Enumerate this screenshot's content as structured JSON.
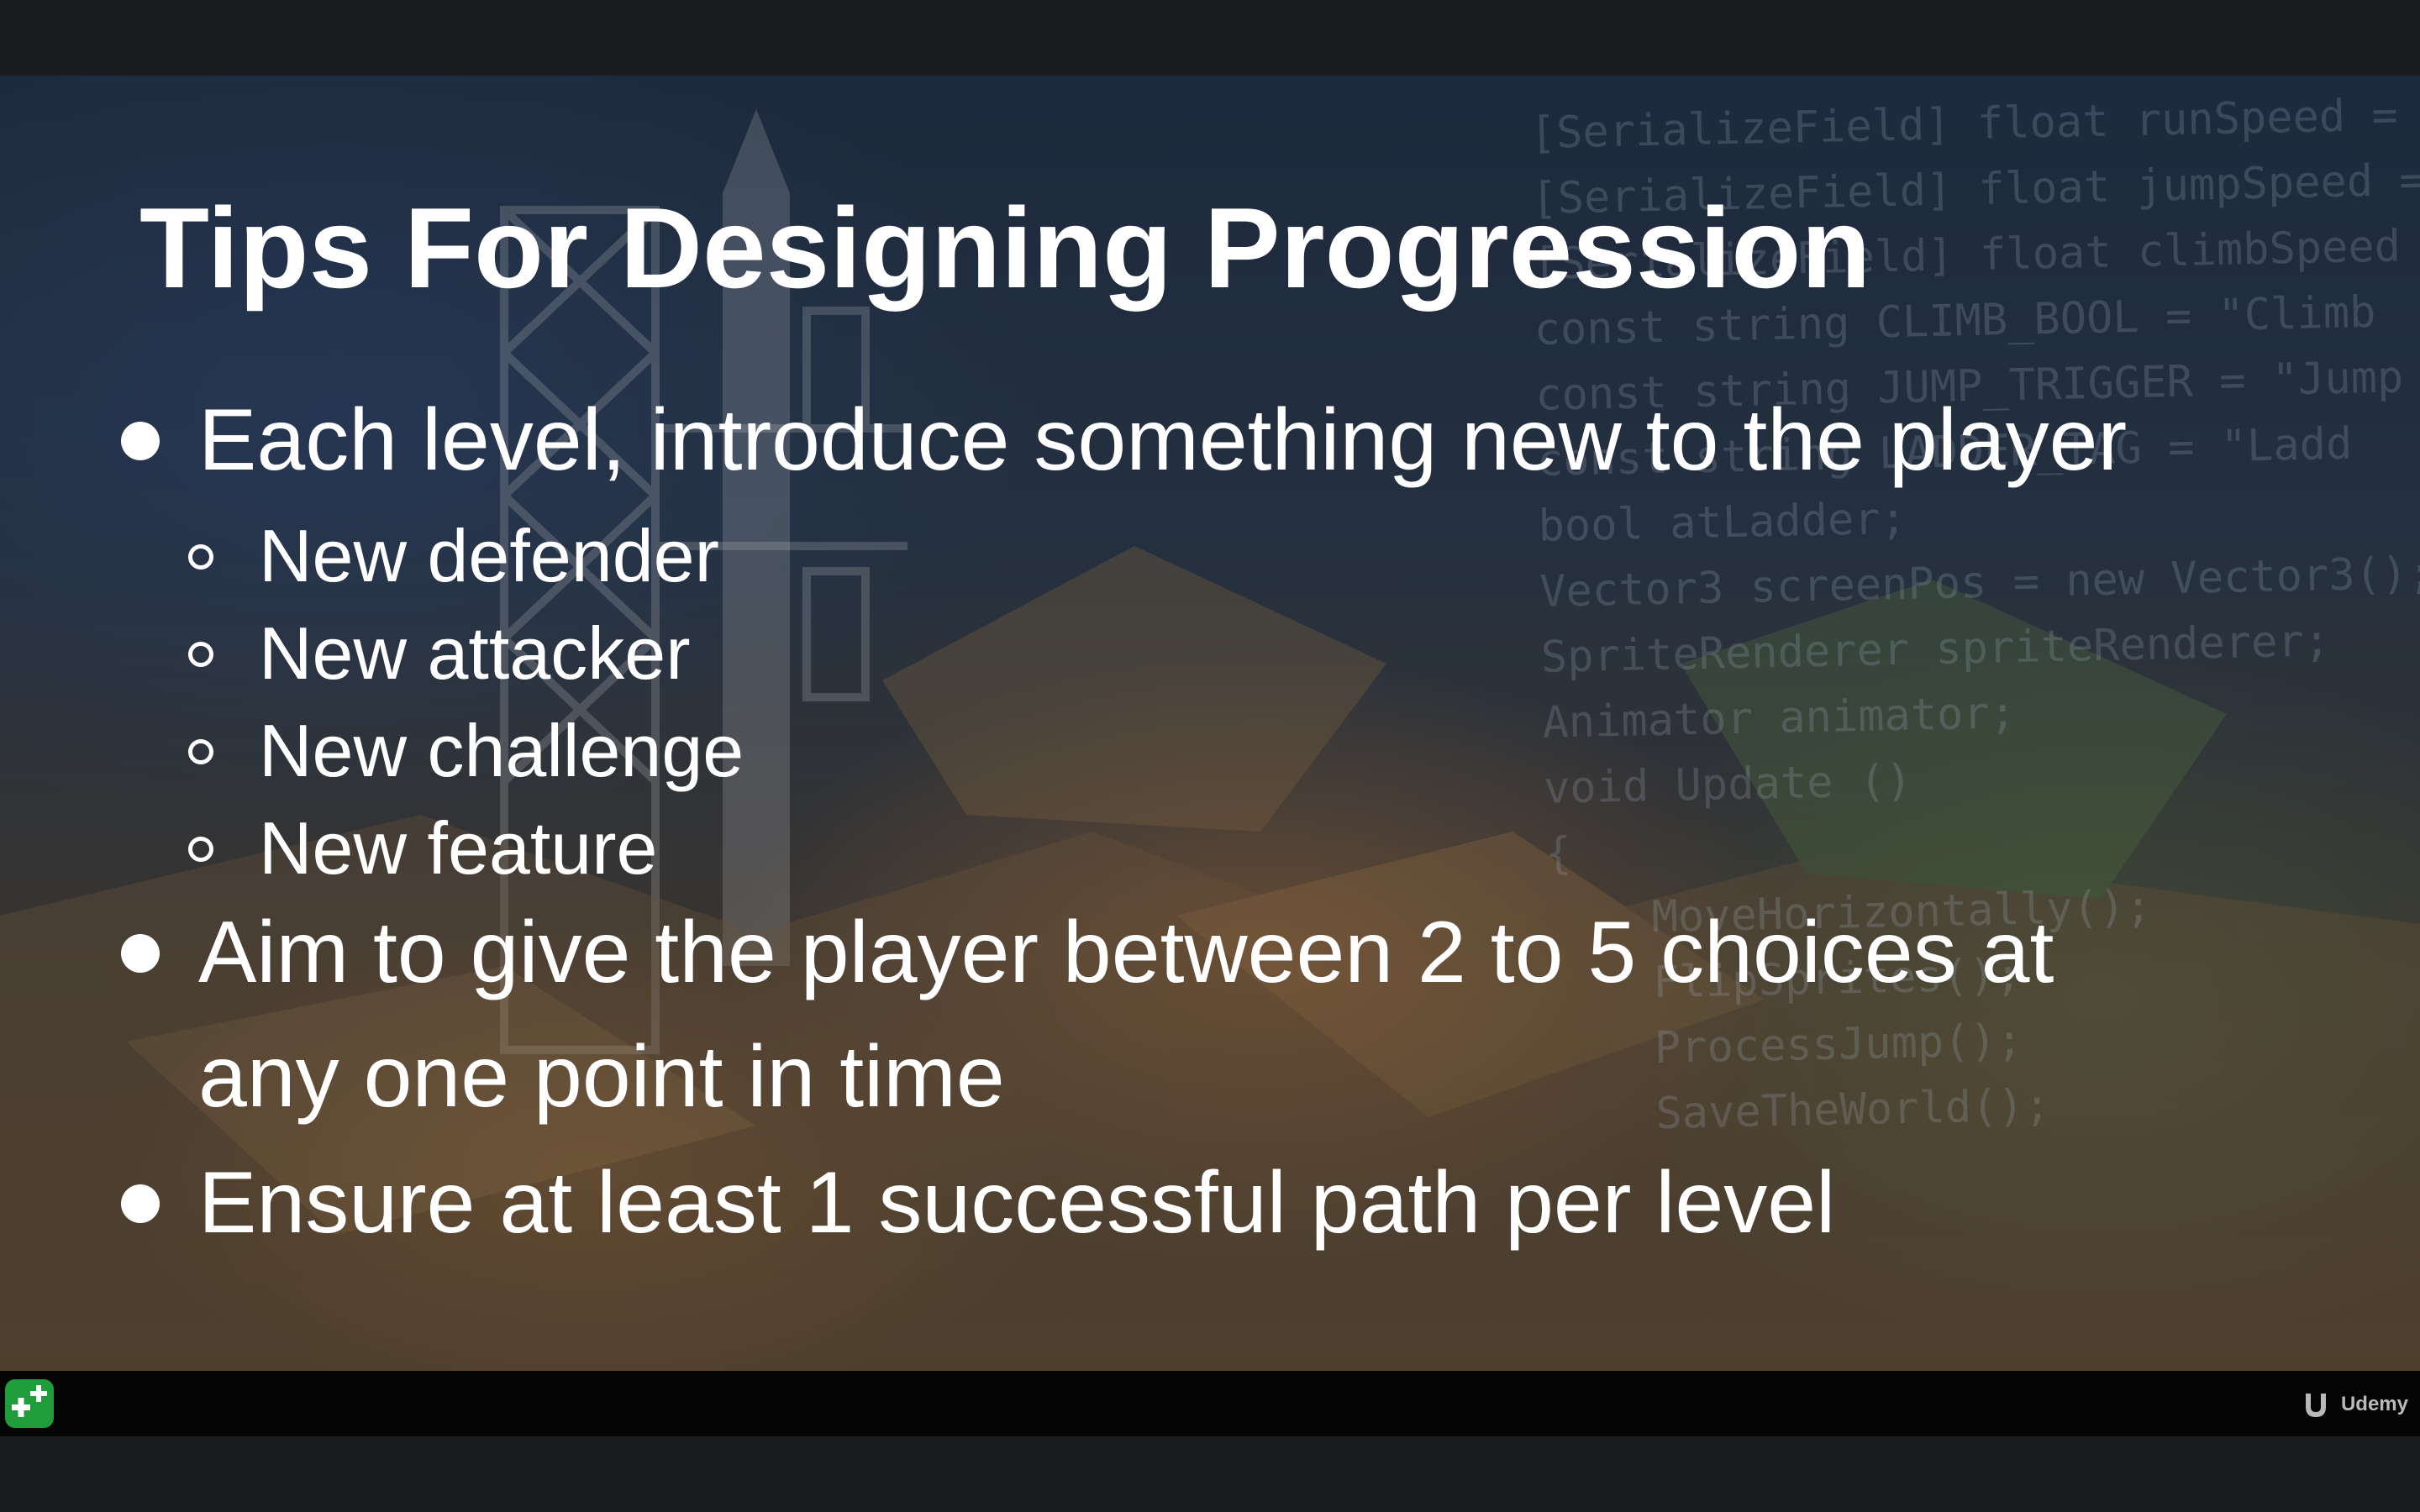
{
  "slide": {
    "title": "Tips For Designing Progression",
    "bullets": [
      {
        "text": "Each level, introduce something new to the player",
        "subitems": [
          "New defender",
          "New attacker",
          "New challenge",
          "New feature"
        ]
      },
      {
        "lines": [
          "Aim to give the player between 2 to 5 choices at",
          "any one point in time"
        ]
      },
      {
        "text": "Ensure at least 1 successful path per level"
      }
    ]
  },
  "background_code": [
    "[SerializeField] float runSpeed =",
    "[SerializeField] float jumpSpeed =",
    "[SerializeField] float climbSpeed",
    "",
    "const string CLIMB_BOOL = \"Climb",
    "const string JUMP_TRIGGER = \"Jump",
    "const string LADDER_TAG = \"Ladd",
    "",
    "bool atLadder;",
    "Vector3 screenPos = new Vector3();",
    "SpriteRenderer spriteRenderer;",
    "Animator animator;",
    "",
    "void Update ()",
    "{",
    "    MoveHorizontally();",
    "    FlipSprites();",
    "    ProcessJump();",
    "    SaveTheWorld();"
  ],
  "footer": {
    "brand_label": "Udemy",
    "app_icon": "green-plus-icon",
    "brand_icon": "udemy-logo-icon"
  },
  "colors": {
    "title_text": "#ffffff",
    "body_text": "#ffffff",
    "app_icon_bg": "#1f9d3a",
    "bottom_bar": "#050505"
  }
}
